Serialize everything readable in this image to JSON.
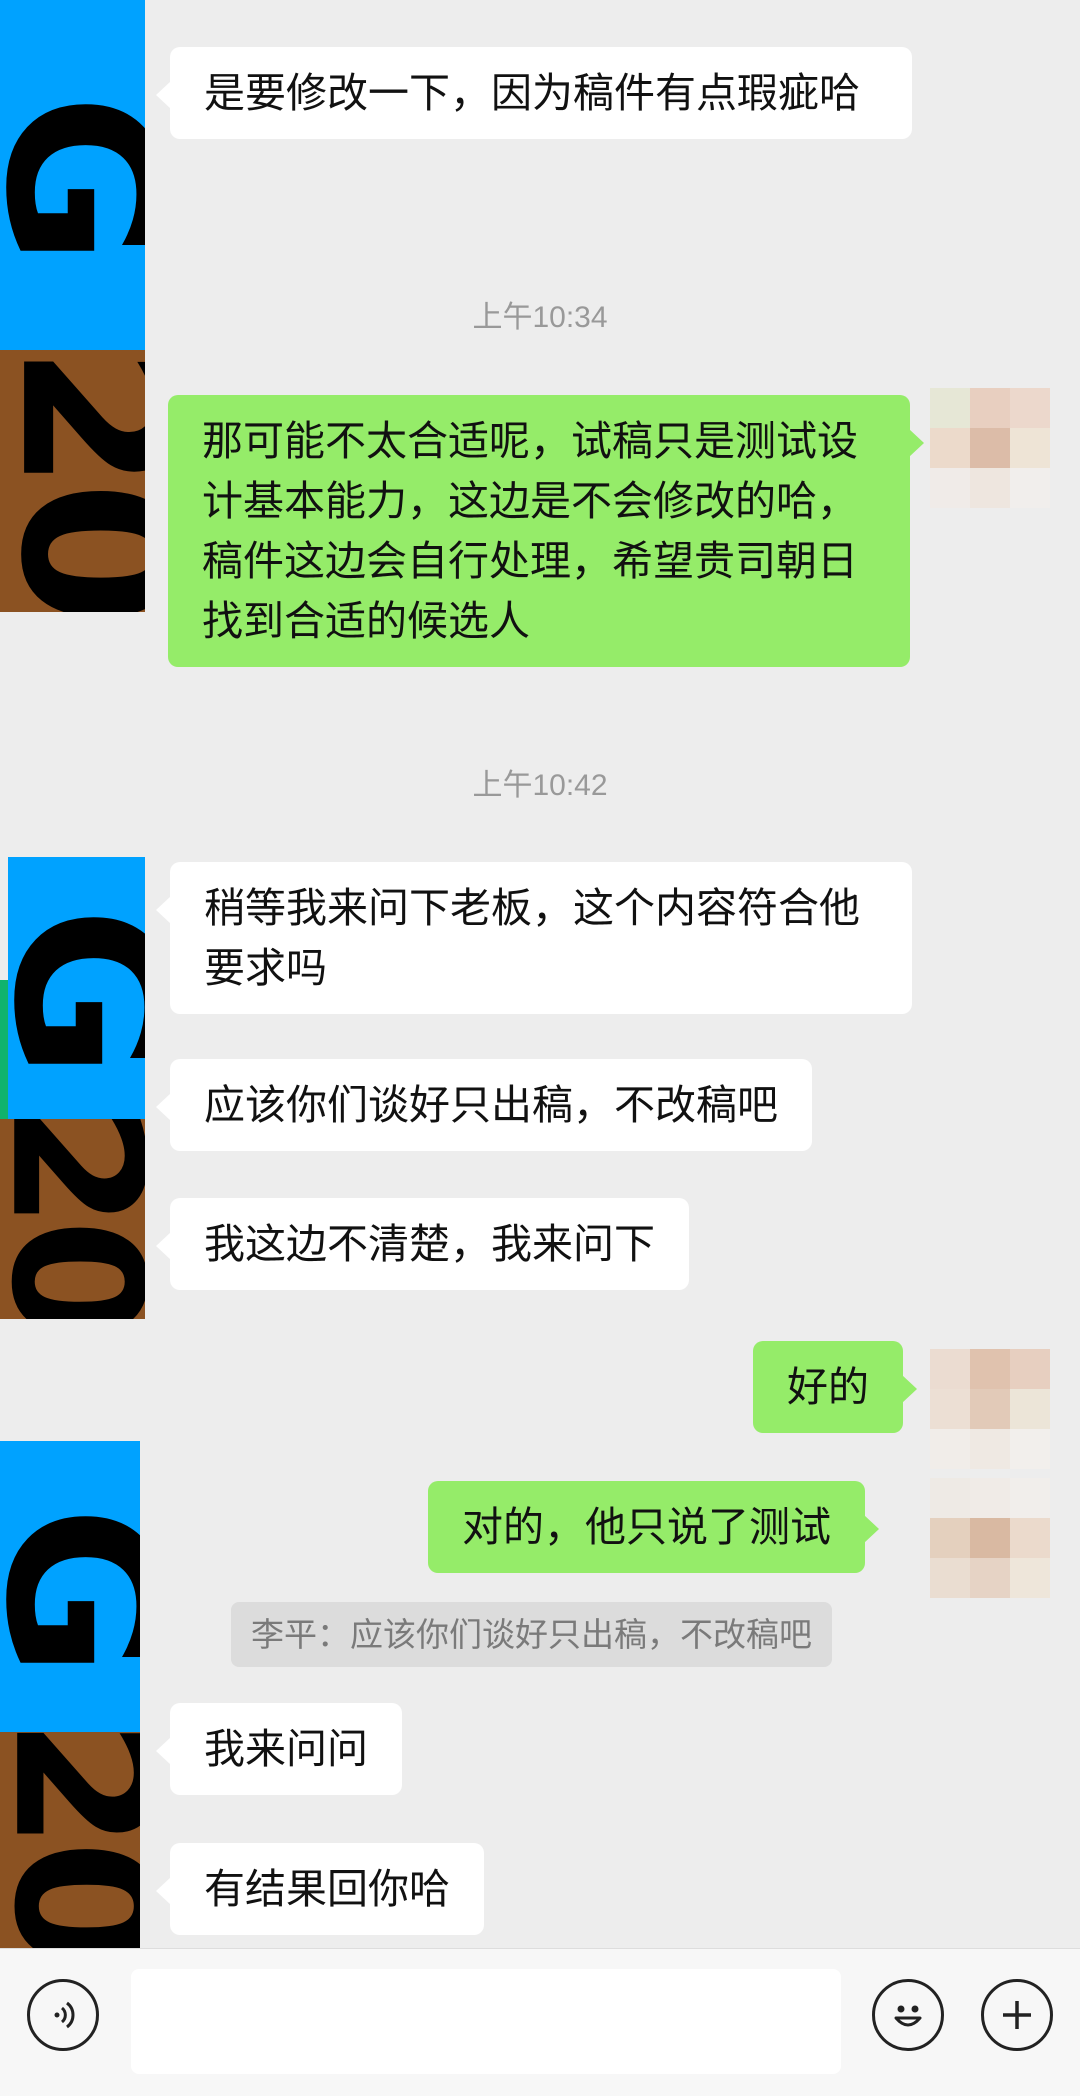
{
  "messages": {
    "m1": "是要修改一下，因为稿件有点瑕疵哈",
    "t1": "上午10:34",
    "m2": "那可能不太合适呢，试稿只是测试设计基本能力，这边是不会修改的哈，稿件这边会自行处理，希望贵司朝日找到合适的候选人",
    "t2": "上午10:42",
    "m3": "稍等我来问下老板，这个内容符合他要求吗",
    "m4": "应该你们谈好只出稿，不改稿吧",
    "m5": "我这边不清楚，我来问下",
    "m6": "好的",
    "m7": "对的，他只说了测试",
    "quote": "李平：应该你们谈好只出稿，不改稿吧",
    "m8": "我来问问",
    "m9": "有结果回你哈"
  },
  "avatar_overlays": {
    "g": "G",
    "n": "20"
  },
  "colors": {
    "background": "#ededed",
    "incoming_bubble": "#ffffff",
    "outgoing_bubble": "#95ec69",
    "overlay_blue": "#00a2ff",
    "overlay_brown": "#8b5222"
  },
  "icons": [
    "voice-icon",
    "emoji-icon",
    "plus-icon"
  ]
}
